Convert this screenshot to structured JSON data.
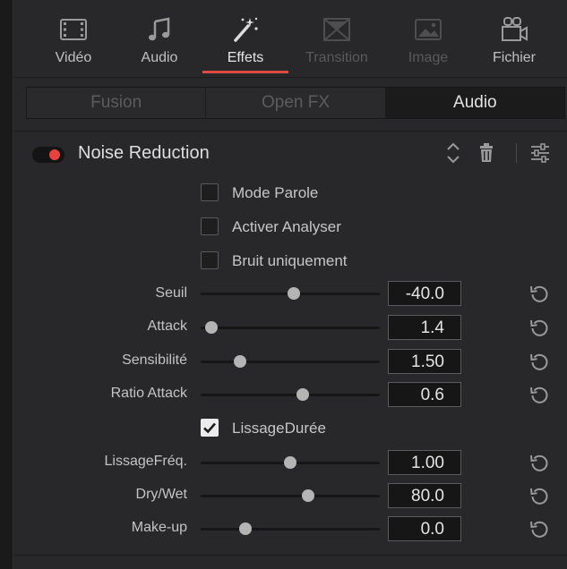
{
  "toolbar": {
    "items": [
      {
        "label": "Vidéo",
        "icon": "film-icon",
        "state": "normal"
      },
      {
        "label": "Audio",
        "icon": "music-note-icon",
        "state": "normal"
      },
      {
        "label": "Effets",
        "icon": "magic-wand-icon",
        "state": "active"
      },
      {
        "label": "Transition",
        "icon": "transition-icon",
        "state": "disabled"
      },
      {
        "label": "Image",
        "icon": "image-icon",
        "state": "disabled"
      },
      {
        "label": "Fichier",
        "icon": "file-icon",
        "state": "normal"
      }
    ],
    "accent_color": "#e04a45"
  },
  "tabs": [
    {
      "label": "Fusion",
      "selected": false
    },
    {
      "label": "Open FX",
      "selected": false
    },
    {
      "label": "Audio",
      "selected": true
    }
  ],
  "effect": {
    "title": "Noise Reduction",
    "enabled": true,
    "toggle_color": "#e8423f"
  },
  "options": [
    {
      "label": "Mode Parole",
      "checked": false
    },
    {
      "label": "Activer Analyser",
      "checked": false
    },
    {
      "label": "Bruit uniquement",
      "checked": false
    }
  ],
  "params_a": [
    {
      "label": "Seuil",
      "value": "-40.0",
      "level": 0.52
    },
    {
      "label": "Attack",
      "value": "1.4",
      "level": 0.06
    },
    {
      "label": "Sensibilité",
      "value": "1.50",
      "level": 0.22
    },
    {
      "label": "Ratio Attack",
      "value": "0.6",
      "level": 0.57
    }
  ],
  "smoothing": {
    "label": "LissageDurée",
    "checked": true
  },
  "params_b": [
    {
      "label": "LissageFréq.",
      "value": "1.00",
      "level": 0.5
    },
    {
      "label": "Dry/Wet",
      "value": "80.0",
      "level": 0.6
    },
    {
      "label": "Make-up",
      "value": "0.0",
      "level": 0.25
    }
  ]
}
